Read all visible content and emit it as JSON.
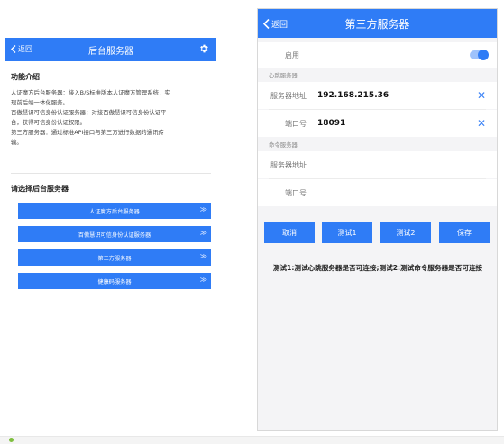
{
  "left_screen": {
    "back_label": "返回",
    "title": "后台服务器",
    "intro_heading": "功能介绍",
    "intro_lines": [
      "人证魔方后台服务器：接入B/S标准版本人证魔方管理系统，实",
      "现前后端一体化服务。",
      "百傲慧识可信身份认证服务器：对接百傲慧识可信身份认证平",
      "台，获得可信身份认证权限。",
      "第三方服务器：通过标准API接口与第三方进行数据的通讯传",
      "输。"
    ],
    "select_heading": "请选择后台服务器",
    "server_buttons": [
      "人证魔方后台服务器",
      "百傲慧识可信身份认证服务器",
      "第三方服务器",
      "健康码服务器"
    ],
    "chevron_text": "≫"
  },
  "right_screen": {
    "back_label": "返回",
    "title": "第三方服务器",
    "enable_label": "启用",
    "enable_state": true,
    "heartbeat_group": "心跳服务器",
    "heartbeat_address_label": "服务器地址",
    "heartbeat_address_value": "192.168.215.36",
    "heartbeat_port_label": "端口号",
    "heartbeat_port_value": "18091",
    "command_group": "命令服务器",
    "command_address_label": "服务器地址",
    "command_port_label": "端口号",
    "clear_glyph": "✕",
    "buttons": {
      "cancel": "取消",
      "test1": "测试1",
      "test2": "测试2",
      "save": "保存"
    },
    "note": "测试1:测试心跳服务器是否可连接;测试2:测试命令服务器是否可连接"
  },
  "colors": {
    "accent": "#2f7cf6",
    "status_dot": "#7fbf3f"
  }
}
